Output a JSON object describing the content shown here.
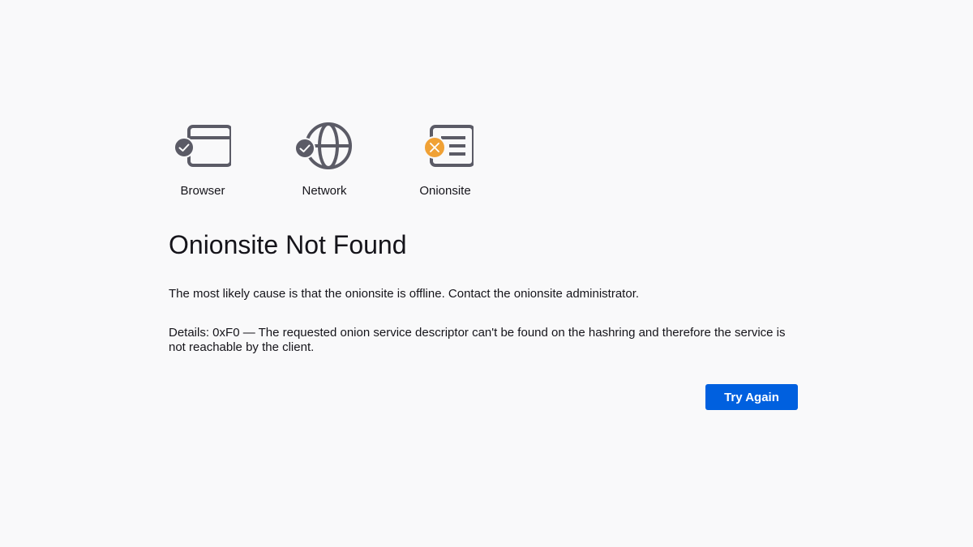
{
  "steps": [
    {
      "label": "Browser",
      "icon": "browser-window-icon",
      "status": "ok",
      "status_icon": "check-icon"
    },
    {
      "label": "Network",
      "icon": "globe-icon",
      "status": "ok",
      "status_icon": "check-icon"
    },
    {
      "label": "Onionsite",
      "icon": "document-list-icon",
      "status": "error",
      "status_icon": "x-icon"
    }
  ],
  "error": {
    "title": "Onionsite Not Found",
    "description": "The most likely cause is that the onionsite is offline. Contact the onionsite administrator.",
    "details": "Details: 0xF0 — The requested onion service descriptor can't be found on the hashring and therefore the service is not reachable by the client."
  },
  "actions": {
    "try_again_label": "Try Again"
  },
  "colors": {
    "background": "#f9f9fa",
    "icon": "#5b5b66",
    "ok_badge": "#5b5b66",
    "error_badge": "#f0a135",
    "button": "#0060df",
    "button_text": "#ffffff"
  }
}
